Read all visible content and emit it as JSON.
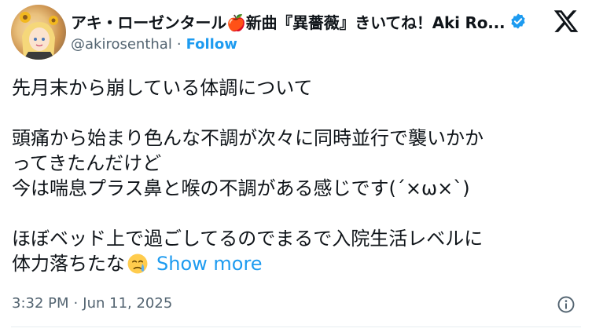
{
  "author": {
    "display_name": "アキ・ローゼンタール🍎新曲『異薔薇』きいてね！Aki Ro...",
    "handle": "@akirosenthal",
    "follow_label": "Follow",
    "verified": true
  },
  "tweet": {
    "paragraphs": [
      [
        "先月末から崩している体調について"
      ],
      [
        "頭痛から始まり色んな不調が次々に同時並行で襲いかか",
        "ってきたんだけど",
        "今は喘息プラス鼻と喉の不調がある感じです(´×ω×`)"
      ],
      [
        "ほぼベッド上で過ごしてるのでまるで入院生活レベルに",
        "体力落ちたな"
      ]
    ],
    "show_more_label": "Show more",
    "time": "3:32 PM",
    "date": "Jun 11, 2025"
  },
  "icons": {
    "verified": "verified-badge-icon",
    "platform": "x-logo-icon",
    "emoji": "face-holding-back-tears-emoji",
    "info": "info-icon"
  },
  "colors": {
    "accent": "#1d9bf0",
    "text": "#0f1419",
    "secondary": "#536471"
  }
}
